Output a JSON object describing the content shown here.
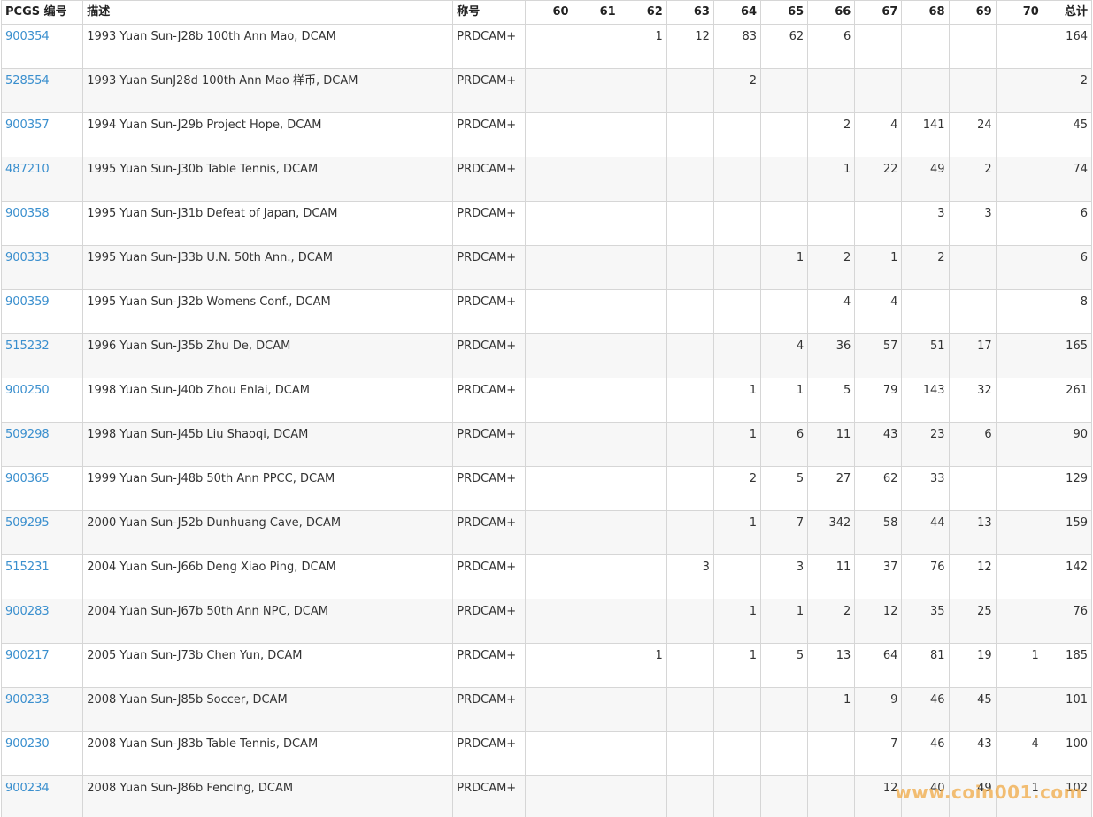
{
  "table": {
    "headers": {
      "pcgs": "PCGS 编号",
      "desc": "描述",
      "desig": "称号",
      "g60": "60",
      "g61": "61",
      "g62": "62",
      "g63": "63",
      "g64": "64",
      "g65": "65",
      "g66": "66",
      "g67": "67",
      "g68": "68",
      "g69": "69",
      "g70": "70",
      "total": "总计"
    },
    "rows": [
      {
        "pcgs": "900354",
        "desc": "1993 Yuan Sun-J28b 100th Ann Mao, DCAM",
        "desig": "PRDCAM+",
        "g60": "",
        "g61": "",
        "g62": "1",
        "g63": "12",
        "g64": "83",
        "g65": "62",
        "g66": "6",
        "g67": "",
        "g68": "",
        "g69": "",
        "g70": "",
        "total": "164"
      },
      {
        "pcgs": "528554",
        "desc": "1993 Yuan SunJ28d 100th Ann Mao 样币, DCAM",
        "desig": "PRDCAM+",
        "g60": "",
        "g61": "",
        "g62": "",
        "g63": "",
        "g64": "2",
        "g65": "",
        "g66": "",
        "g67": "",
        "g68": "",
        "g69": "",
        "g70": "",
        "total": "2"
      },
      {
        "pcgs": "900357",
        "desc": "1994 Yuan Sun-J29b Project Hope, DCAM",
        "desig": "PRDCAM+",
        "g60": "",
        "g61": "",
        "g62": "",
        "g63": "",
        "g64": "",
        "g65": "",
        "g66": "2",
        "g67": "4",
        "g68": "141",
        "g69": "24",
        "g70": "",
        "total": "45"
      },
      {
        "pcgs": "487210",
        "desc": "1995 Yuan Sun-J30b Table Tennis, DCAM",
        "desig": "PRDCAM+",
        "g60": "",
        "g61": "",
        "g62": "",
        "g63": "",
        "g64": "",
        "g65": "",
        "g66": "1",
        "g67": "22",
        "g68": "49",
        "g69": "2",
        "g70": "",
        "total": "74"
      },
      {
        "pcgs": "900358",
        "desc": "1995 Yuan Sun-J31b Defeat of Japan, DCAM",
        "desig": "PRDCAM+",
        "g60": "",
        "g61": "",
        "g62": "",
        "g63": "",
        "g64": "",
        "g65": "",
        "g66": "",
        "g67": "",
        "g68": "3",
        "g69": "3",
        "g70": "",
        "total": "6"
      },
      {
        "pcgs": "900333",
        "desc": "1995 Yuan Sun-J33b U.N. 50th Ann., DCAM",
        "desig": "PRDCAM+",
        "g60": "",
        "g61": "",
        "g62": "",
        "g63": "",
        "g64": "",
        "g65": "1",
        "g66": "2",
        "g67": "1",
        "g68": "2",
        "g69": "",
        "g70": "",
        "total": "6"
      },
      {
        "pcgs": "900359",
        "desc": "1995 Yuan Sun-J32b Womens Conf., DCAM",
        "desig": "PRDCAM+",
        "g60": "",
        "g61": "",
        "g62": "",
        "g63": "",
        "g64": "",
        "g65": "",
        "g66": "4",
        "g67": "4",
        "g68": "",
        "g69": "",
        "g70": "",
        "total": "8"
      },
      {
        "pcgs": "515232",
        "desc": "1996 Yuan Sun-J35b Zhu De, DCAM",
        "desig": "PRDCAM+",
        "g60": "",
        "g61": "",
        "g62": "",
        "g63": "",
        "g64": "",
        "g65": "4",
        "g66": "36",
        "g67": "57",
        "g68": "51",
        "g69": "17",
        "g70": "",
        "total": "165"
      },
      {
        "pcgs": "900250",
        "desc": "1998 Yuan Sun-J40b Zhou Enlai, DCAM",
        "desig": "PRDCAM+",
        "g60": "",
        "g61": "",
        "g62": "",
        "g63": "",
        "g64": "1",
        "g65": "1",
        "g66": "5",
        "g67": "79",
        "g68": "143",
        "g69": "32",
        "g70": "",
        "total": "261"
      },
      {
        "pcgs": "509298",
        "desc": "1998 Yuan Sun-J45b Liu Shaoqi, DCAM",
        "desig": "PRDCAM+",
        "g60": "",
        "g61": "",
        "g62": "",
        "g63": "",
        "g64": "1",
        "g65": "6",
        "g66": "11",
        "g67": "43",
        "g68": "23",
        "g69": "6",
        "g70": "",
        "total": "90"
      },
      {
        "pcgs": "900365",
        "desc": "1999 Yuan Sun-J48b 50th Ann PPCC, DCAM",
        "desig": "PRDCAM+",
        "g60": "",
        "g61": "",
        "g62": "",
        "g63": "",
        "g64": "2",
        "g65": "5",
        "g66": "27",
        "g67": "62",
        "g68": "33",
        "g69": "",
        "g70": "",
        "total": "129"
      },
      {
        "pcgs": "509295",
        "desc": "2000 Yuan Sun-J52b Dunhuang Cave, DCAM",
        "desig": "PRDCAM+",
        "g60": "",
        "g61": "",
        "g62": "",
        "g63": "",
        "g64": "1",
        "g65": "7",
        "g66": "342",
        "g67": "58",
        "g68": "44",
        "g69": "13",
        "g70": "",
        "total": "159"
      },
      {
        "pcgs": "515231",
        "desc": "2004 Yuan Sun-J66b Deng Xiao Ping, DCAM",
        "desig": "PRDCAM+",
        "g60": "",
        "g61": "",
        "g62": "",
        "g63": "3",
        "g64": "",
        "g65": "3",
        "g66": "11",
        "g67": "37",
        "g68": "76",
        "g69": "12",
        "g70": "",
        "total": "142"
      },
      {
        "pcgs": "900283",
        "desc": "2004 Yuan Sun-J67b 50th Ann NPC, DCAM",
        "desig": "PRDCAM+",
        "g60": "",
        "g61": "",
        "g62": "",
        "g63": "",
        "g64": "1",
        "g65": "1",
        "g66": "2",
        "g67": "12",
        "g68": "35",
        "g69": "25",
        "g70": "",
        "total": "76"
      },
      {
        "pcgs": "900217",
        "desc": "2005 Yuan Sun-J73b Chen Yun, DCAM",
        "desig": "PRDCAM+",
        "g60": "",
        "g61": "",
        "g62": "1",
        "g63": "",
        "g64": "1",
        "g65": "5",
        "g66": "13",
        "g67": "64",
        "g68": "81",
        "g69": "19",
        "g70": "1",
        "total": "185"
      },
      {
        "pcgs": "900233",
        "desc": "2008 Yuan Sun-J85b Soccer, DCAM",
        "desig": "PRDCAM+",
        "g60": "",
        "g61": "",
        "g62": "",
        "g63": "",
        "g64": "",
        "g65": "",
        "g66": "1",
        "g67": "9",
        "g68": "46",
        "g69": "45",
        "g70": "",
        "total": "101"
      },
      {
        "pcgs": "900230",
        "desc": "2008 Yuan Sun-J83b Table Tennis, DCAM",
        "desig": "PRDCAM+",
        "g60": "",
        "g61": "",
        "g62": "",
        "g63": "",
        "g64": "",
        "g65": "",
        "g66": "",
        "g67": "7",
        "g68": "46",
        "g69": "43",
        "g70": "4",
        "total": "100"
      },
      {
        "pcgs": "900234",
        "desc": "2008 Yuan Sun-J86b Fencing, DCAM",
        "desig": "PRDCAM+",
        "g60": "",
        "g61": "",
        "g62": "",
        "g63": "",
        "g64": "",
        "g65": "",
        "g66": "",
        "g67": "12",
        "g68": "40",
        "g69": "49",
        "g70": "1",
        "total": "102"
      }
    ]
  },
  "watermark": "www.coin001.com"
}
